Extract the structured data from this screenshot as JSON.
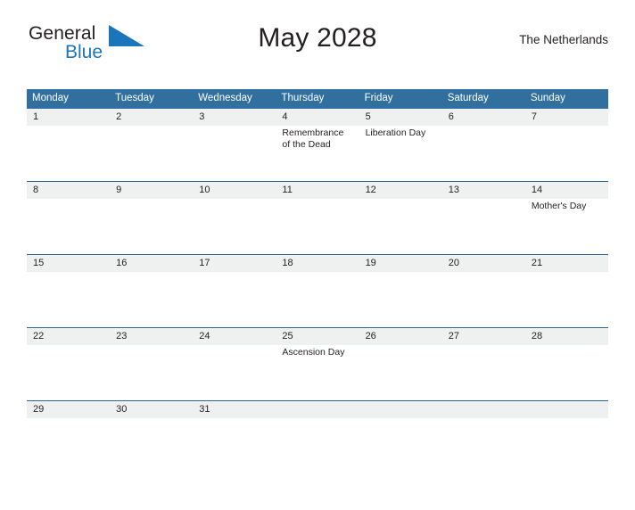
{
  "brand": {
    "name_part1": "General",
    "name_part2": "Blue",
    "flag_icon": "blue-triangle-flag-icon",
    "accent_color": "#1b75bb"
  },
  "header": {
    "title": "May 2028",
    "country": "The Netherlands"
  },
  "calendar": {
    "header_bg": "#31709e",
    "daynum_bg": "#eff0f0",
    "row_border": "#2a6496",
    "weekday_headers": [
      "Monday",
      "Tuesday",
      "Wednesday",
      "Thursday",
      "Friday",
      "Saturday",
      "Sunday"
    ],
    "weeks": [
      {
        "days": [
          {
            "num": "1",
            "event": ""
          },
          {
            "num": "2",
            "event": ""
          },
          {
            "num": "3",
            "event": ""
          },
          {
            "num": "4",
            "event": "Remembrance of the Dead"
          },
          {
            "num": "5",
            "event": "Liberation Day"
          },
          {
            "num": "6",
            "event": ""
          },
          {
            "num": "7",
            "event": ""
          }
        ]
      },
      {
        "days": [
          {
            "num": "8",
            "event": ""
          },
          {
            "num": "9",
            "event": ""
          },
          {
            "num": "10",
            "event": ""
          },
          {
            "num": "11",
            "event": ""
          },
          {
            "num": "12",
            "event": ""
          },
          {
            "num": "13",
            "event": ""
          },
          {
            "num": "14",
            "event": "Mother's Day"
          }
        ]
      },
      {
        "days": [
          {
            "num": "15",
            "event": ""
          },
          {
            "num": "16",
            "event": ""
          },
          {
            "num": "17",
            "event": ""
          },
          {
            "num": "18",
            "event": ""
          },
          {
            "num": "19",
            "event": ""
          },
          {
            "num": "20",
            "event": ""
          },
          {
            "num": "21",
            "event": ""
          }
        ]
      },
      {
        "days": [
          {
            "num": "22",
            "event": ""
          },
          {
            "num": "23",
            "event": ""
          },
          {
            "num": "24",
            "event": ""
          },
          {
            "num": "25",
            "event": "Ascension Day"
          },
          {
            "num": "26",
            "event": ""
          },
          {
            "num": "27",
            "event": ""
          },
          {
            "num": "28",
            "event": ""
          }
        ]
      },
      {
        "days": [
          {
            "num": "29",
            "event": ""
          },
          {
            "num": "30",
            "event": ""
          },
          {
            "num": "31",
            "event": ""
          },
          {
            "num": "",
            "event": ""
          },
          {
            "num": "",
            "event": ""
          },
          {
            "num": "",
            "event": ""
          },
          {
            "num": "",
            "event": ""
          }
        ]
      }
    ]
  }
}
